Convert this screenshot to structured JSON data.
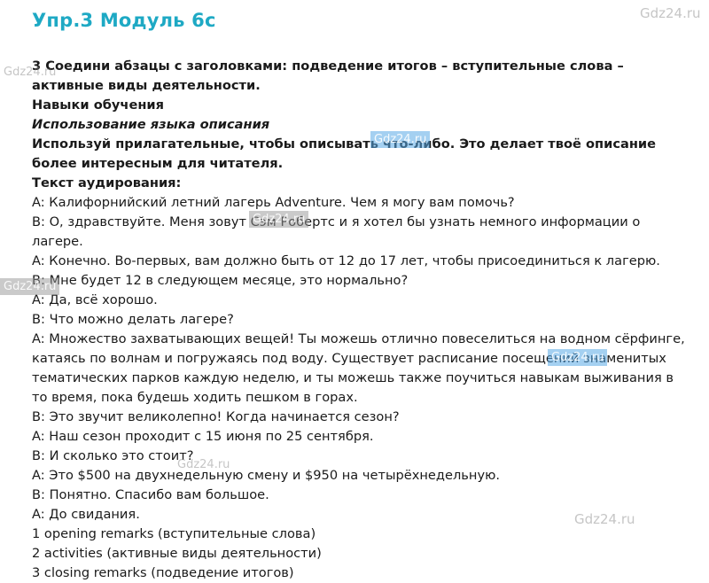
{
  "title": "Упр.3 Модуль 6c",
  "watermark": "Gdz24.ru",
  "lines": [
    {
      "style": "bold",
      "text": "3 Соедини абзацы с заголовками: подведение итогов – вступительные слова – активные виды деятельности."
    },
    {
      "style": "bold",
      "text": "Навыки обучения"
    },
    {
      "style": "bolditalic",
      "text": "Использование языка описания"
    },
    {
      "style": "bold",
      "text": "Используй прилагательные, чтобы описывать что-либо. Это делает твоё описание более интересным для читателя."
    },
    {
      "style": "bold",
      "text": "Текст аудирования:"
    },
    {
      "style": "normal",
      "text": "A: Калифорнийский летний лагерь Adventure. Чем я могу вам помочь?"
    },
    {
      "style": "normal",
      "text": "B: О, здравствуйте. Меня зовут Сэм Робертс и я хотел бы узнать немного информации о лагере."
    },
    {
      "style": "normal",
      "text": "A: Конечно. Во-первых, вам должно быть от 12 до 17 лет, чтобы присоединиться к лагерю."
    },
    {
      "style": "normal",
      "text": "B: Мне будет 12 в следующем месяце, это нормально?"
    },
    {
      "style": "normal",
      "text": "A: Да, всё хорошо."
    },
    {
      "style": "normal",
      "text": "B: Что можно делать лагере?"
    },
    {
      "style": "normal",
      "text": "A: Множество захватывающих вещей! Ты можешь отлично повеселиться на водном сёрфинге, катаясь по волнам и погружаясь под воду. Существует расписание посещений знаменитых тематических парков каждую неделю, и ты можешь также поучиться навыкам выживания в то время, пока будешь ходить пешком в горах."
    },
    {
      "style": "normal",
      "text": "B: Это звучит великолепно! Когда начинается сезон?"
    },
    {
      "style": "normal",
      "text": "A: Наш сезон проходит с 15 июня по 25 сентября."
    },
    {
      "style": "normal",
      "text": "B: И сколько это стоит?"
    },
    {
      "style": "normal",
      "text": "A: Это $500 на двухнедельную смену и $950 на четырёхнедельную."
    },
    {
      "style": "normal",
      "text": "B: Понятно. Спасибо вам большое."
    },
    {
      "style": "normal",
      "text": "A: До свидания."
    },
    {
      "style": "normal",
      "text": "1 opening remarks (вступительные слова)"
    },
    {
      "style": "normal",
      "text": "2 activities (активные виды деятельности)"
    },
    {
      "style": "normal",
      "text": "3 closing remarks (подведение итогов)"
    }
  ]
}
